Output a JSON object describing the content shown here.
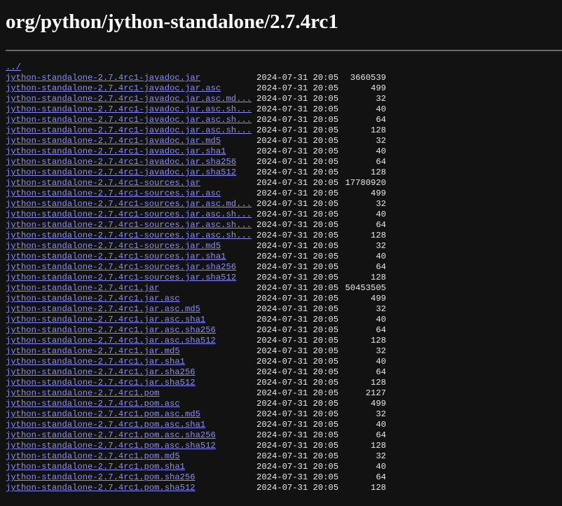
{
  "title": "org/python/jython-standalone/2.7.4rc1",
  "parent_link": "../",
  "files": [
    {
      "name": "jython-standalone-2.7.4rc1-javadoc.jar",
      "date": "2024-07-31 20:05",
      "size": "3660539"
    },
    {
      "name": "jython-standalone-2.7.4rc1-javadoc.jar.asc",
      "date": "2024-07-31 20:05",
      "size": "499"
    },
    {
      "name": "jython-standalone-2.7.4rc1-javadoc.jar.asc.md...",
      "date": "2024-07-31 20:05",
      "size": "32"
    },
    {
      "name": "jython-standalone-2.7.4rc1-javadoc.jar.asc.sh...",
      "date": "2024-07-31 20:05",
      "size": "40"
    },
    {
      "name": "jython-standalone-2.7.4rc1-javadoc.jar.asc.sh...",
      "date": "2024-07-31 20:05",
      "size": "64"
    },
    {
      "name": "jython-standalone-2.7.4rc1-javadoc.jar.asc.sh...",
      "date": "2024-07-31 20:05",
      "size": "128"
    },
    {
      "name": "jython-standalone-2.7.4rc1-javadoc.jar.md5",
      "date": "2024-07-31 20:05",
      "size": "32"
    },
    {
      "name": "jython-standalone-2.7.4rc1-javadoc.jar.sha1",
      "date": "2024-07-31 20:05",
      "size": "40"
    },
    {
      "name": "jython-standalone-2.7.4rc1-javadoc.jar.sha256",
      "date": "2024-07-31 20:05",
      "size": "64"
    },
    {
      "name": "jython-standalone-2.7.4rc1-javadoc.jar.sha512",
      "date": "2024-07-31 20:05",
      "size": "128"
    },
    {
      "name": "jython-standalone-2.7.4rc1-sources.jar",
      "date": "2024-07-31 20:05",
      "size": "17780920"
    },
    {
      "name": "jython-standalone-2.7.4rc1-sources.jar.asc",
      "date": "2024-07-31 20:05",
      "size": "499"
    },
    {
      "name": "jython-standalone-2.7.4rc1-sources.jar.asc.md...",
      "date": "2024-07-31 20:05",
      "size": "32"
    },
    {
      "name": "jython-standalone-2.7.4rc1-sources.jar.asc.sh...",
      "date": "2024-07-31 20:05",
      "size": "40"
    },
    {
      "name": "jython-standalone-2.7.4rc1-sources.jar.asc.sh...",
      "date": "2024-07-31 20:05",
      "size": "64"
    },
    {
      "name": "jython-standalone-2.7.4rc1-sources.jar.asc.sh...",
      "date": "2024-07-31 20:05",
      "size": "128"
    },
    {
      "name": "jython-standalone-2.7.4rc1-sources.jar.md5",
      "date": "2024-07-31 20:05",
      "size": "32"
    },
    {
      "name": "jython-standalone-2.7.4rc1-sources.jar.sha1",
      "date": "2024-07-31 20:05",
      "size": "40"
    },
    {
      "name": "jython-standalone-2.7.4rc1-sources.jar.sha256",
      "date": "2024-07-31 20:05",
      "size": "64"
    },
    {
      "name": "jython-standalone-2.7.4rc1-sources.jar.sha512",
      "date": "2024-07-31 20:05",
      "size": "128"
    },
    {
      "name": "jython-standalone-2.7.4rc1.jar",
      "date": "2024-07-31 20:05",
      "size": "50453505"
    },
    {
      "name": "jython-standalone-2.7.4rc1.jar.asc",
      "date": "2024-07-31 20:05",
      "size": "499"
    },
    {
      "name": "jython-standalone-2.7.4rc1.jar.asc.md5",
      "date": "2024-07-31 20:05",
      "size": "32"
    },
    {
      "name": "jython-standalone-2.7.4rc1.jar.asc.sha1",
      "date": "2024-07-31 20:05",
      "size": "40"
    },
    {
      "name": "jython-standalone-2.7.4rc1.jar.asc.sha256",
      "date": "2024-07-31 20:05",
      "size": "64"
    },
    {
      "name": "jython-standalone-2.7.4rc1.jar.asc.sha512",
      "date": "2024-07-31 20:05",
      "size": "128"
    },
    {
      "name": "jython-standalone-2.7.4rc1.jar.md5",
      "date": "2024-07-31 20:05",
      "size": "32"
    },
    {
      "name": "jython-standalone-2.7.4rc1.jar.sha1",
      "date": "2024-07-31 20:05",
      "size": "40"
    },
    {
      "name": "jython-standalone-2.7.4rc1.jar.sha256",
      "date": "2024-07-31 20:05",
      "size": "64"
    },
    {
      "name": "jython-standalone-2.7.4rc1.jar.sha512",
      "date": "2024-07-31 20:05",
      "size": "128"
    },
    {
      "name": "jython-standalone-2.7.4rc1.pom",
      "date": "2024-07-31 20:05",
      "size": "2127"
    },
    {
      "name": "jython-standalone-2.7.4rc1.pom.asc",
      "date": "2024-07-31 20:05",
      "size": "499"
    },
    {
      "name": "jython-standalone-2.7.4rc1.pom.asc.md5",
      "date": "2024-07-31 20:05",
      "size": "32"
    },
    {
      "name": "jython-standalone-2.7.4rc1.pom.asc.sha1",
      "date": "2024-07-31 20:05",
      "size": "40"
    },
    {
      "name": "jython-standalone-2.7.4rc1.pom.asc.sha256",
      "date": "2024-07-31 20:05",
      "size": "64"
    },
    {
      "name": "jython-standalone-2.7.4rc1.pom.asc.sha512",
      "date": "2024-07-31 20:05",
      "size": "128"
    },
    {
      "name": "jython-standalone-2.7.4rc1.pom.md5",
      "date": "2024-07-31 20:05",
      "size": "32"
    },
    {
      "name": "jython-standalone-2.7.4rc1.pom.sha1",
      "date": "2024-07-31 20:05",
      "size": "40"
    },
    {
      "name": "jython-standalone-2.7.4rc1.pom.sha256",
      "date": "2024-07-31 20:05",
      "size": "64"
    },
    {
      "name": "jython-standalone-2.7.4rc1.pom.sha512",
      "date": "2024-07-31 20:05",
      "size": "128"
    }
  ],
  "colors": {
    "background": "#121212",
    "link": "#8c8cf7",
    "text": "#e8e8e8",
    "rule": "#6a6a6a"
  }
}
